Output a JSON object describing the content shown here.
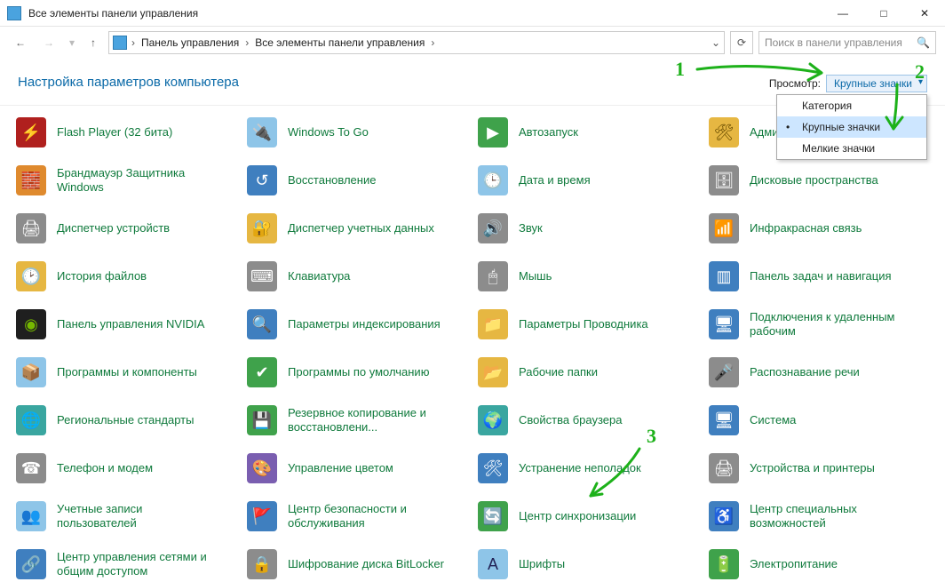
{
  "window": {
    "title": "Все элементы панели управления"
  },
  "nav": {
    "crumb1": "Панель управления",
    "crumb2": "Все элементы панели управления",
    "search_placeholder": "Поиск в панели управления"
  },
  "header": {
    "title": "Настройка параметров компьютера",
    "view_label": "Просмотр:",
    "view_value": "Крупные значки"
  },
  "dropdown_options": {
    "opt1": "Категория",
    "opt2": "Крупные значки",
    "opt3": "Мелкие значки"
  },
  "items": {
    "i0": "Flash Player (32 бита)",
    "i1": "Windows To Go",
    "i2": "Автозапуск",
    "i3": "Админи",
    "i4": "Брандмауэр Защитника Windows",
    "i5": "Восстановление",
    "i6": "Дата и время",
    "i7": "Дисковые пространства",
    "i8": "Диспетчер устройств",
    "i9": "Диспетчер учетных данных",
    "i10": "Звук",
    "i11": "Инфракрасная связь",
    "i12": "История файлов",
    "i13": "Клавиатура",
    "i14": "Мышь",
    "i15": "Панель задач и навигация",
    "i16": "Панель управления NVIDIA",
    "i17": "Параметры индексирования",
    "i18": "Параметры Проводника",
    "i19": "Подключения к удаленным рабочим",
    "i20": "Программы и компоненты",
    "i21": "Программы по умолчанию",
    "i22": "Рабочие папки",
    "i23": "Распознавание речи",
    "i24": "Региональные стандарты",
    "i25": "Резервное копирование и восстановлени...",
    "i26": "Свойства браузера",
    "i27": "Система",
    "i28": "Телефон и модем",
    "i29": "Управление цветом",
    "i30": "Устранение неполадок",
    "i31": "Устройства и принтеры",
    "i32": "Учетные записи пользователей",
    "i33": "Центр безопасности и обслуживания",
    "i34": "Центр синхронизации",
    "i35": "Центр специальных возможностей",
    "i36": "Центр управления сетями и общим доступом",
    "i37": "Шифрование диска BitLocker",
    "i38": "Шрифты",
    "i39": "Электропитание"
  },
  "annotations": {
    "n1": "1",
    "n2": "2",
    "n3": "3"
  }
}
